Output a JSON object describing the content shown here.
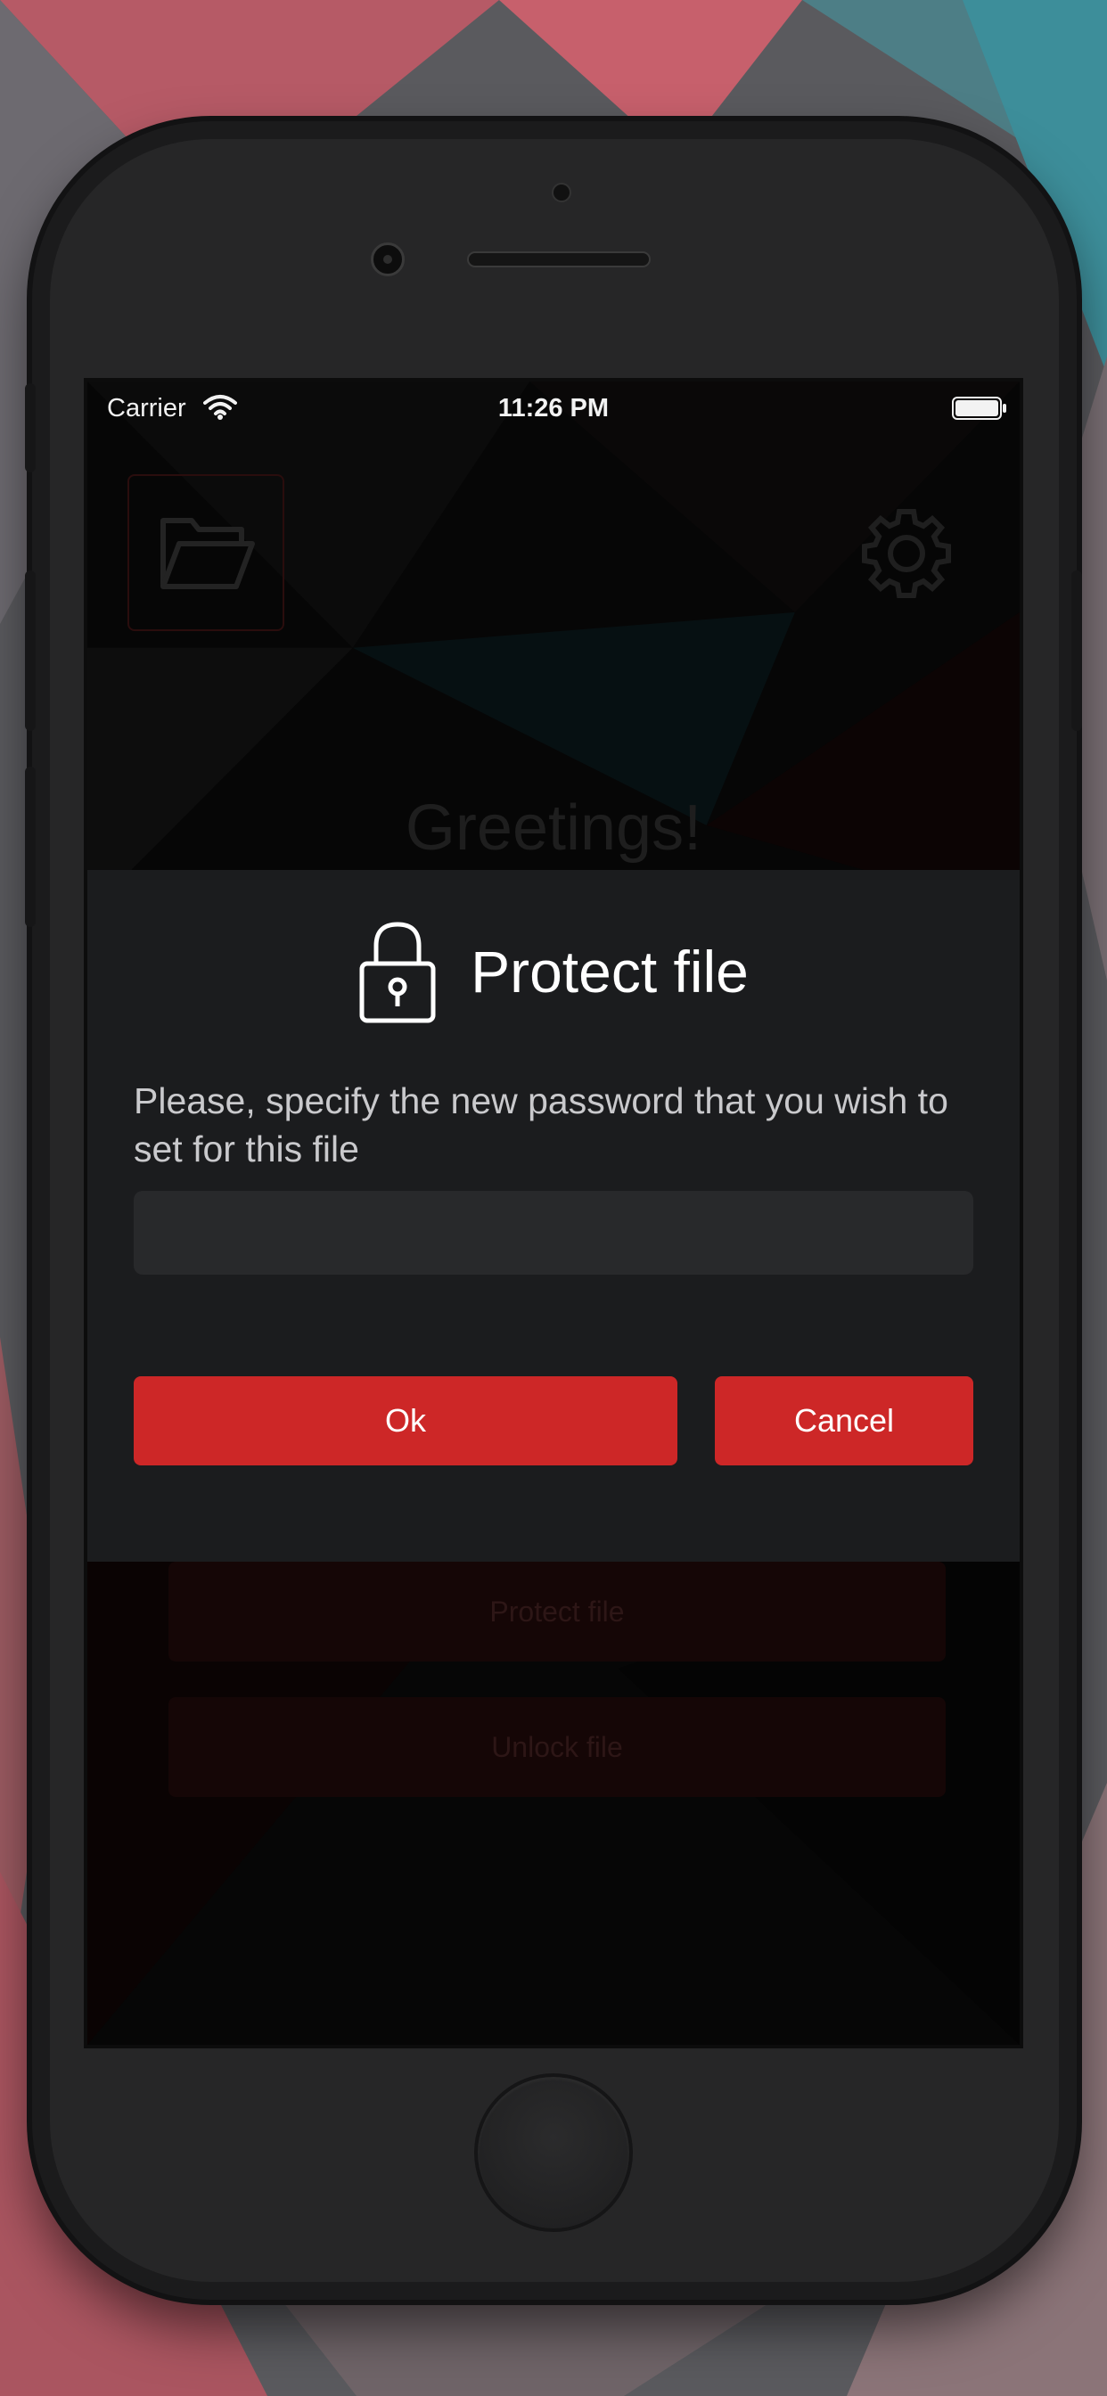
{
  "status_bar": {
    "carrier": "Carrier",
    "time": "11:26 PM"
  },
  "home": {
    "folder_icon": "folder-open-icon",
    "settings_icon": "gear-icon",
    "greeting": "Greetings!",
    "protect_button_label": "Protect file",
    "unlock_button_label": "Unlock file"
  },
  "dialog": {
    "icon": "lock-icon",
    "title": "Protect file",
    "message": "Please, specify the new password that you wish to set for this file",
    "password_value": "",
    "ok_label": "Ok",
    "cancel_label": "Cancel"
  },
  "colors": {
    "accent": "#cd2727",
    "dialog_background": "#1b1c1e",
    "field_background": "#28292b"
  }
}
